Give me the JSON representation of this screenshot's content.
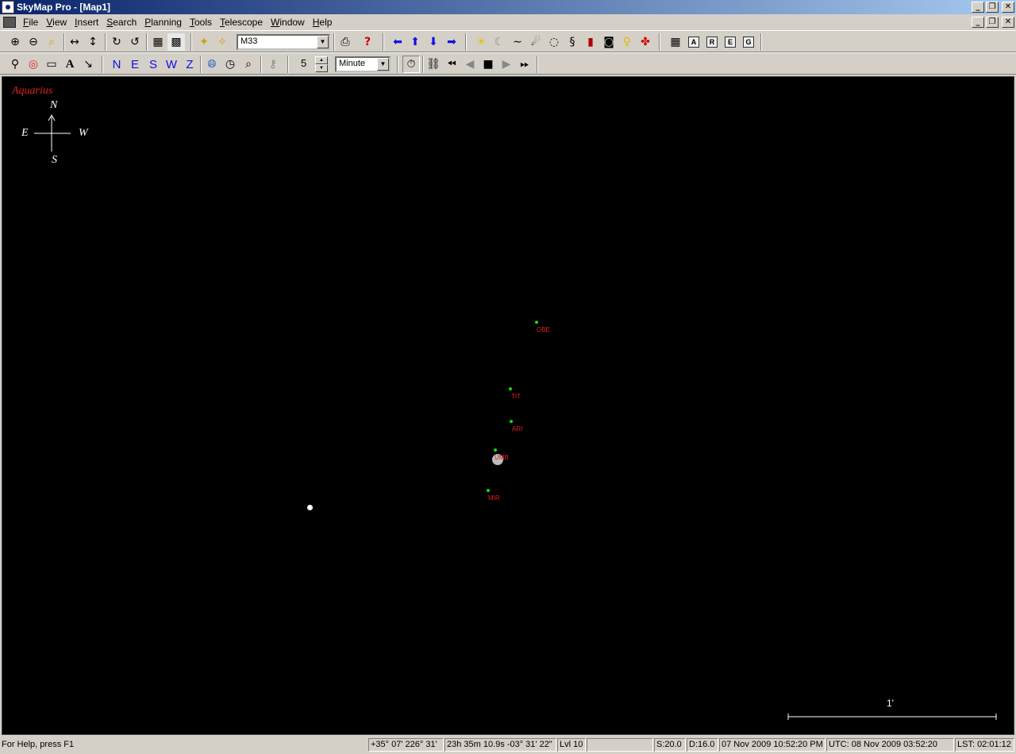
{
  "window": {
    "title": "SkyMap Pro - [Map1]",
    "controls": {
      "minimize": "_",
      "restore": "❐",
      "close": "✕"
    }
  },
  "menu": [
    "File",
    "View",
    "Insert",
    "Search",
    "Planning",
    "Tools",
    "Telescope",
    "Window",
    "Help"
  ],
  "toolbar1": {
    "object_combo_value": "M33",
    "icons": [
      "zoom-in-icon",
      "zoom-out-icon",
      "zoom-box-icon",
      "flip-horizontal-icon",
      "flip-vertical-icon",
      "rotate-cw-icon",
      "rotate-ccw-icon",
      "grid-icon",
      "horizon-grid-icon",
      "center-star-icon",
      "find-star-icon",
      "print-icon",
      "context-help-icon",
      "pan-left-icon",
      "pan-up-icon",
      "pan-down-icon",
      "pan-right-icon",
      "sun-icon",
      "moon-icon",
      "comet-icon",
      "asteroid-icon",
      "galaxy-icon",
      "nebula-icon",
      "planets-icon",
      "camera-icon",
      "bulb-icon",
      "color-icon",
      "coord-grid-icon"
    ],
    "boxed_letters": [
      "A",
      "R",
      "E",
      "G"
    ]
  },
  "toolbar2": {
    "direction_buttons": [
      "N",
      "E",
      "S",
      "W",
      "Z"
    ],
    "step_value": "5",
    "step_unit": "Minute",
    "icons": [
      "telescope-icon",
      "target-icon",
      "rectangle-icon",
      "text-icon",
      "arrow-icon",
      "globe-icon",
      "compass-icon",
      "find-icon",
      "key-icon",
      "stopwatch-icon",
      "link-icon",
      "fast-back-icon",
      "step-back-icon",
      "stop-icon",
      "step-forward-icon",
      "fast-forward-icon"
    ],
    "text_tool": "A"
  },
  "map": {
    "constellation": "Aquarius",
    "compass": {
      "n": "N",
      "e": "E",
      "w": "W",
      "s": "S"
    },
    "objects": [
      {
        "label": "OBE"
      },
      {
        "label": "TIT"
      },
      {
        "label": "ARI"
      },
      {
        "label": "UMB"
      },
      {
        "label": "MIR"
      }
    ],
    "scale_label": "1'",
    "colors": {
      "background": "#000000",
      "labels": "#e02020",
      "moons": "#18d818"
    }
  },
  "statusbar": {
    "help": "For Help, press F1",
    "altaz": "+35° 07'  226° 31'",
    "radec": "23h 35m 10.9s  -03° 31' 22\"",
    "level": "Lvl 10",
    "blank": "",
    "s_val": "S:20.0",
    "d_val": "D:16.0",
    "local_time": "07 Nov 2009 10:52:20 PM",
    "utc": "UTC: 08 Nov 2009 03:52:20",
    "lst": "LST: 02:01:12"
  }
}
